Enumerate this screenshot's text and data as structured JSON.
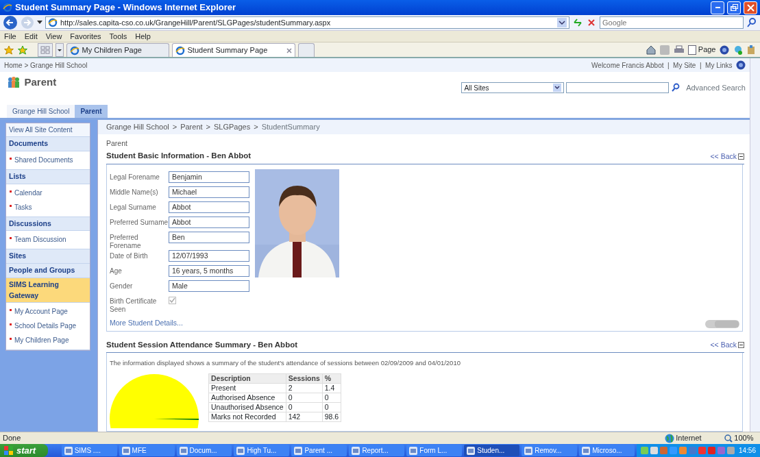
{
  "window": {
    "title": "Student Summary Page - Windows Internet Explorer"
  },
  "browser": {
    "address": "http://sales.capita-cso.co.uk/GrangeHill/Parent/SLGPages/studentSummary.aspx",
    "search_placeholder": "Google",
    "menu": [
      "File",
      "Edit",
      "View",
      "Favorites",
      "Tools",
      "Help"
    ],
    "tabs": [
      {
        "label": "My Children Page",
        "selected": false
      },
      {
        "label": "Student Summary Page",
        "selected": true
      }
    ],
    "command_page": "Page"
  },
  "site": {
    "breadcrumb": "Home > Grange Hill School",
    "link_separator": "|",
    "user_links": [
      "Welcome Francis Abbot",
      "My Site",
      "My Links"
    ],
    "title": "Parent",
    "scope": "All Sites",
    "advanced_search": "Advanced Search",
    "top_tabs": [
      {
        "label": "Grange Hill School",
        "selected": false
      },
      {
        "label": "Parent",
        "selected": true
      }
    ]
  },
  "quick_launch": [
    {
      "kind": "link",
      "label": "View All Site Content",
      "selected": false
    },
    {
      "kind": "heading",
      "label": "Documents",
      "selected": false,
      "children": [
        {
          "label": "Shared Documents"
        }
      ]
    },
    {
      "kind": "heading",
      "label": "Lists",
      "selected": false,
      "children": [
        {
          "label": "Calendar"
        },
        {
          "label": "Tasks"
        }
      ]
    },
    {
      "kind": "heading",
      "label": "Discussions",
      "selected": false,
      "children": [
        {
          "label": "Team Discussion"
        }
      ]
    },
    {
      "kind": "heading",
      "label": "Sites",
      "selected": false
    },
    {
      "kind": "heading",
      "label": "People and Groups",
      "selected": false
    },
    {
      "kind": "heading",
      "label": "SIMS Learning Gateway",
      "selected": true,
      "children": [
        {
          "label": "My Account Page"
        },
        {
          "label": "School Details Page"
        },
        {
          "label": "My Children Page"
        }
      ]
    }
  ],
  "content": {
    "breadcrumb_separator": ">",
    "breadcrumb": [
      "Grange Hill School",
      "Parent",
      "SLGPages",
      "StudentSummary"
    ],
    "page_label": "Parent",
    "basic_info": {
      "title": "Student Basic Information - Ben Abbot",
      "back": "<< Back",
      "fields": [
        {
          "label": "Legal Forename",
          "value": "Benjamin"
        },
        {
          "label": "Middle Name(s)",
          "value": "Michael"
        },
        {
          "label": "Legal Surname",
          "value": "Abbot"
        },
        {
          "label": "Preferred Surname",
          "value": "Abbot"
        },
        {
          "label": "Preferred Forename",
          "value": "Ben"
        },
        {
          "label": "Date of Birth",
          "value": "12/07/1993"
        },
        {
          "label": "Age",
          "value": "16 years, 5 months"
        },
        {
          "label": "Gender",
          "value": "Male"
        }
      ],
      "birth_certificate": {
        "label": "Birth Certificate Seen",
        "checked": true,
        "disabled": true
      },
      "more_link": "More Student Details..."
    },
    "attendance": {
      "title": "Student Session Attendance Summary - Ben Abbot",
      "back": "<< Back",
      "description": "The information displayed shows a summary of the student's attendance of sessions between 02/09/2009 and 04/01/2010",
      "columns": [
        "Description",
        "Sessions",
        "%"
      ],
      "rows": [
        [
          "Present",
          "2",
          "1.4"
        ],
        [
          "Authorised Absence",
          "0",
          "0"
        ],
        [
          "Unauthorised Absence",
          "0",
          "0"
        ],
        [
          "Marks not Recorded",
          "142",
          "98.6"
        ]
      ]
    }
  },
  "status_bar": {
    "text": "Done",
    "zone": "Internet",
    "zoom": "100%"
  },
  "taskbar": {
    "start": "start",
    "items": [
      {
        "label": "SIMS ....",
        "selected": false
      },
      {
        "label": "MFE",
        "selected": false
      },
      {
        "label": "Docum...",
        "selected": false
      },
      {
        "label": "High Tu...",
        "selected": false
      },
      {
        "label": "Parent ...",
        "selected": false
      },
      {
        "label": "Report...",
        "selected": false
      },
      {
        "label": "Form L...",
        "selected": false
      },
      {
        "label": "Studen...",
        "selected": true
      },
      {
        "label": "Remov...",
        "selected": false
      },
      {
        "label": "Microso...",
        "selected": false
      }
    ],
    "clock": "14:56"
  }
}
